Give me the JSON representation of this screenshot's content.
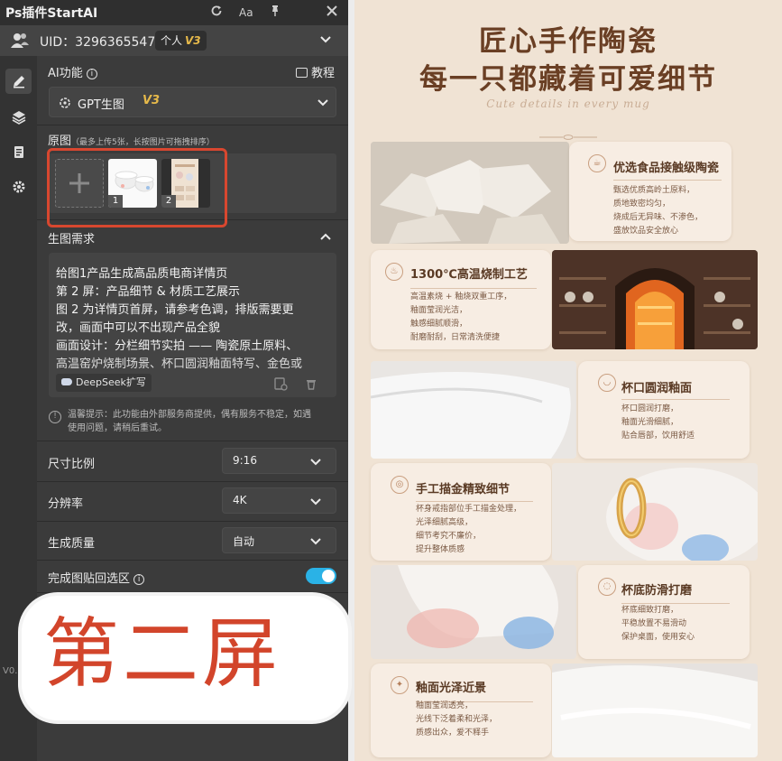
{
  "window": {
    "title": "Ps插件StartAI",
    "refresh_icon": "refresh-icon",
    "font_icon_label": "Aa",
    "pin_icon": "pin-icon",
    "close_icon": "close-icon"
  },
  "account": {
    "uid": "UID：3296365547",
    "plan_label": "个人",
    "plan_version": "V3"
  },
  "ai_feature": {
    "label": "AI功能",
    "tutorial_label": "教程",
    "selected_model": "GPT生图",
    "model_version": "V3"
  },
  "source_images": {
    "label": "原图",
    "hint": "（最多上传5张，长按图片可拖拽排序）",
    "thumbs": [
      {
        "index": "1"
      },
      {
        "index": "2"
      }
    ]
  },
  "requirements": {
    "label": "生图需求",
    "lines": [
      "给图1产品生成高品质电商详情页",
      "第 2 屏：产品细节 & 材质工艺展示",
      "图 2 为详情页首屏，请参考色调，排版需要更",
      "改，画面中可以不出现产品全貌",
      "画面设计：分栏细节实拍 —— 陶瓷原土原料、",
      "高温窑炉烧制场景、杯口圆润釉面特写、金色或"
    ],
    "deepseek_label": "DeepSeek扩写"
  },
  "notice": {
    "line1": "温馨提示：此功能由外部服务商提供，偶有服务不稳定，如遇",
    "line2": "使用问题，请稍后重试。"
  },
  "settings": {
    "aspect_label": "尺寸比例",
    "aspect_value": "9:16",
    "resolution_label": "分辨率",
    "resolution_value": "4K",
    "quality_label": "生成质量",
    "quality_value": "自动",
    "paste_back_label": "完成图贴回选区",
    "paste_back_on": true
  },
  "overlay": {
    "text": "第二屏"
  },
  "sidebar_peek": {
    "version_fragment": "V0."
  },
  "poster": {
    "headline1": "匠心手作陶瓷",
    "headline2": "每一只都藏着可爱细节",
    "script": "Cute details in every mug",
    "sections": [
      {
        "title": "优选食品接触级陶瓷",
        "lines": [
          "甄选优质高岭土原料，",
          "质地致密均匀，",
          "烧成后无异味、不渗色，",
          "盛放饮品安全放心"
        ]
      },
      {
        "title": "1300℃高温烧制工艺",
        "lines": [
          "高温素烧 + 釉烧双重工序，",
          "釉面莹润光洁，",
          "触感细腻顺滑，",
          "耐磨耐刮，日常清洗便捷"
        ]
      },
      {
        "title": "杯口圆润釉面",
        "lines": [
          "杯口圆润打磨，",
          "釉面光滑细腻，",
          "贴合唇部，饮用舒适"
        ]
      },
      {
        "title": "手工描金精致细节",
        "lines": [
          "杯身戒指部位手工描金处理，",
          "光泽细腻高级，",
          "细节考究不廉价，",
          "提升整体质感"
        ]
      },
      {
        "title": "杯底防滑打磨",
        "lines": [
          "杯底细致打磨，",
          "平稳放置不易滑动",
          "保护桌面，使用安心"
        ]
      },
      {
        "title": "釉面光泽近景",
        "lines": [
          "釉面莹润透亮，",
          "光线下泛着柔和光泽，",
          "质感出众，爱不释手"
        ]
      }
    ],
    "colors": {
      "background": "#f0e3d4",
      "headline": "#6a3f24",
      "card": "#f7ede3"
    }
  },
  "colors": {
    "panel_bg": "#3b3b3b",
    "accent_toggle": "#2ab2e6",
    "highlight_red": "#d8472f",
    "version_gold": "#e6b94a"
  }
}
